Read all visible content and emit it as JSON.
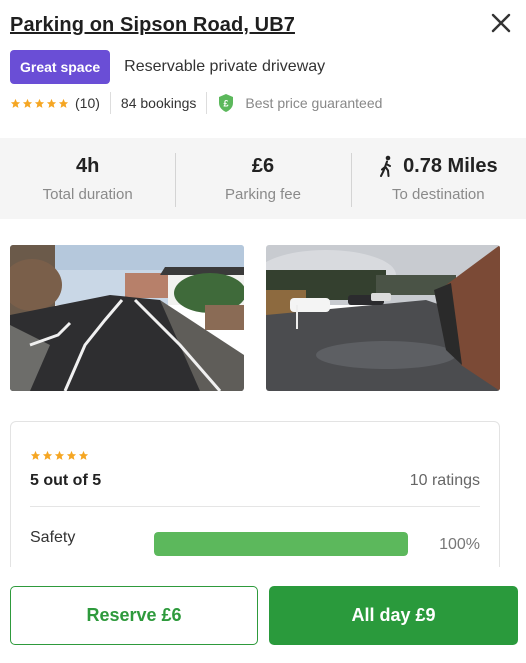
{
  "header": {
    "title": "Parking on Sipson Road, UB7",
    "badge": "Great space",
    "subtitle": "Reservable private driveway",
    "review_count": "(10)",
    "bookings": "84 bookings",
    "price_guarantee": "Best price guaranteed"
  },
  "stats": [
    {
      "value": "4h",
      "label": "Total duration"
    },
    {
      "value": "£6",
      "label": "Parking fee"
    },
    {
      "value": "0.78 Miles",
      "label": "To destination",
      "icon": "walking-person-icon"
    }
  ],
  "ratings": {
    "stars": 5,
    "score": "5 out of 5",
    "count": "10 ratings",
    "categories": [
      {
        "label": "Safety",
        "percent": "100%",
        "fill": 1.0
      }
    ]
  },
  "actions": {
    "reserve_label": "Reserve £6",
    "allday_label": "All day £9"
  },
  "colors": {
    "badge": "#6a4ed6",
    "star": "#f5a623",
    "primary_green": "#2a9a3c",
    "bar_green": "#5cb85c",
    "shield_green": "#5cb85c"
  }
}
